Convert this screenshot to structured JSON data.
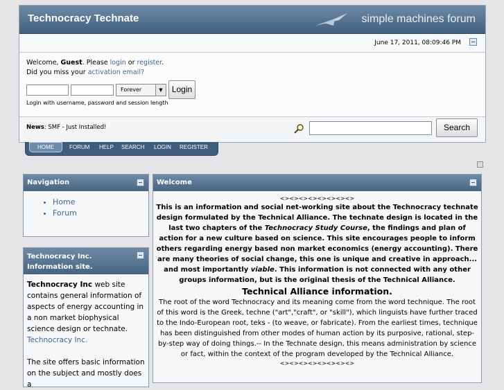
{
  "header": {
    "forum_title": "Technocracy Technate",
    "logo_text": "simple machines forum",
    "date": "June 17, 2011, 08:09:46 PM"
  },
  "userbox": {
    "welcome_prefix": "Welcome, ",
    "guest": "Guest",
    "please": ". Please ",
    "login_link": "login",
    "or": " or ",
    "register_link": "register",
    "period": ".",
    "missed_prefix": "Did you miss your ",
    "activation_link": "activation email?",
    "session_option": "Forever",
    "login_button": "Login",
    "hint": "Login with username, password and session length"
  },
  "news": {
    "label": "News",
    "text": ": SMF - Just Installed!",
    "search_button": "Search",
    "search_value": ""
  },
  "menu": [
    "HOME",
    "FORUM",
    "HELP",
    "SEARCH",
    "LOGIN",
    "REGISTER"
  ],
  "navigation": {
    "title": "Navigation",
    "items": [
      "Home",
      "Forum"
    ]
  },
  "info_panel": {
    "title": "Technocracy Inc. Information site.",
    "p1_bold": "Technocracy Inc",
    "p1_text": " web site contains general information of aspects of energy accounting in a non market biophysical science design or technate. ",
    "p1_link": "Technocracy Inc.",
    "p2_text": "The site offers basic information on the subject and mostly does a"
  },
  "welcome_panel": {
    "title": "Welcome",
    "divider": "<><><><><><><><>",
    "bold_a": "This is an information and social net-working site about the Technocracy technate design formulated by the Technical Alliance. The technate design is located in the last two chapters of the ",
    "bold_italic": "Technocracy Study Course",
    "bold_b": ", the findings and plan of action for a new culture based on science. This site encourages people to inform others regarding energy based non market economics (energy accounting). There are many theories of social change, this one is unique and creative in approach... and most importantly ",
    "bold_italic2": "viable",
    "bold_c": ". This information is not connected with any other groups information, but is the original thesis of the Technical Alliance.",
    "heading": "Technical Alliance information.",
    "body": "The root of the word Technocracy and its meaning come from the word technique. The root of this word is the Greek, techne (\"art\",\"craft\", or \"skill\"), which linguists have further traced to the Indo-European root, teks - (to weave, or fabricate). From the earliest times, technique has been distinguished from other modes of human action by its purposive, rational, step-by-step way of doing things.-- In the Technate design, this means administration by science or fact, within the context of the program developed by the Technical Alliance.",
    "divider2": "<><><><><><><><>"
  }
}
